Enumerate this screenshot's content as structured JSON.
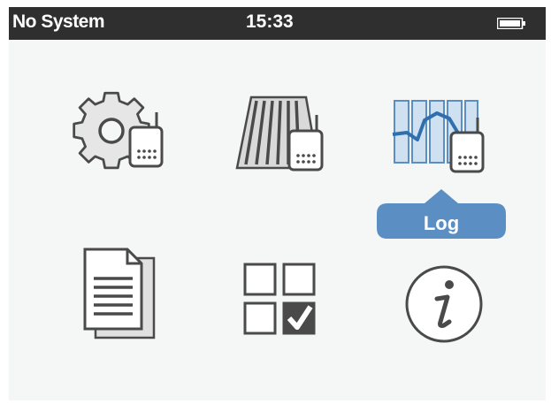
{
  "statusbar": {
    "system_label": "No System",
    "time": "15:33",
    "battery_icon": "battery-full-icon"
  },
  "menu": {
    "items": [
      {
        "name": "settings",
        "icon": "gear-with-receiver-icon"
      },
      {
        "name": "solar-panel",
        "icon": "solar-panel-with-receiver-icon"
      },
      {
        "name": "log",
        "icon": "log-chart-with-receiver-icon",
        "selected": true
      },
      {
        "name": "document",
        "icon": "document-icon"
      },
      {
        "name": "checklist",
        "icon": "checklist-grid-icon"
      },
      {
        "name": "info",
        "icon": "info-icon"
      }
    ],
    "selected_label": "Log"
  },
  "colors": {
    "statusbar_bg": "#2f2f2f",
    "screen_bg": "#f4f7f6",
    "accent": "#5b8fc4",
    "icon_stroke": "#4a4a4a"
  }
}
